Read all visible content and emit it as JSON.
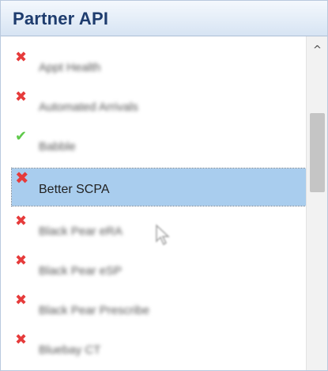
{
  "panel": {
    "title": "Partner API"
  },
  "list": {
    "items": [
      {
        "label": "Appt Health",
        "status": "fail",
        "status_icon": "x-mark-icon",
        "selected": false,
        "blurred": true
      },
      {
        "label": "Automated Arrivals",
        "status": "fail",
        "status_icon": "x-mark-icon",
        "selected": false,
        "blurred": true
      },
      {
        "label": "Babble",
        "status": "ok",
        "status_icon": "check-mark-icon",
        "selected": false,
        "blurred": true
      },
      {
        "label": "Better SCPA",
        "status": "fail",
        "status_icon": "x-mark-icon",
        "selected": true,
        "blurred": false
      },
      {
        "label": "Black Pear eRA",
        "status": "fail",
        "status_icon": "x-mark-icon",
        "selected": false,
        "blurred": true
      },
      {
        "label": "Black Pear eSP",
        "status": "fail",
        "status_icon": "x-mark-icon",
        "selected": false,
        "blurred": true
      },
      {
        "label": "Black Pear Prescribe",
        "status": "fail",
        "status_icon": "x-mark-icon",
        "selected": false,
        "blurred": true
      },
      {
        "label": "Bluebay CT",
        "status": "fail",
        "status_icon": "x-mark-icon",
        "selected": false,
        "blurred": true
      }
    ]
  },
  "scrollbar": {
    "up_icon": "chevron-up-icon"
  },
  "colors": {
    "header_text": "#1e3c6e",
    "selected_bg": "#a9cdee",
    "fail": "#e63b3b",
    "ok": "#5fc94a"
  }
}
